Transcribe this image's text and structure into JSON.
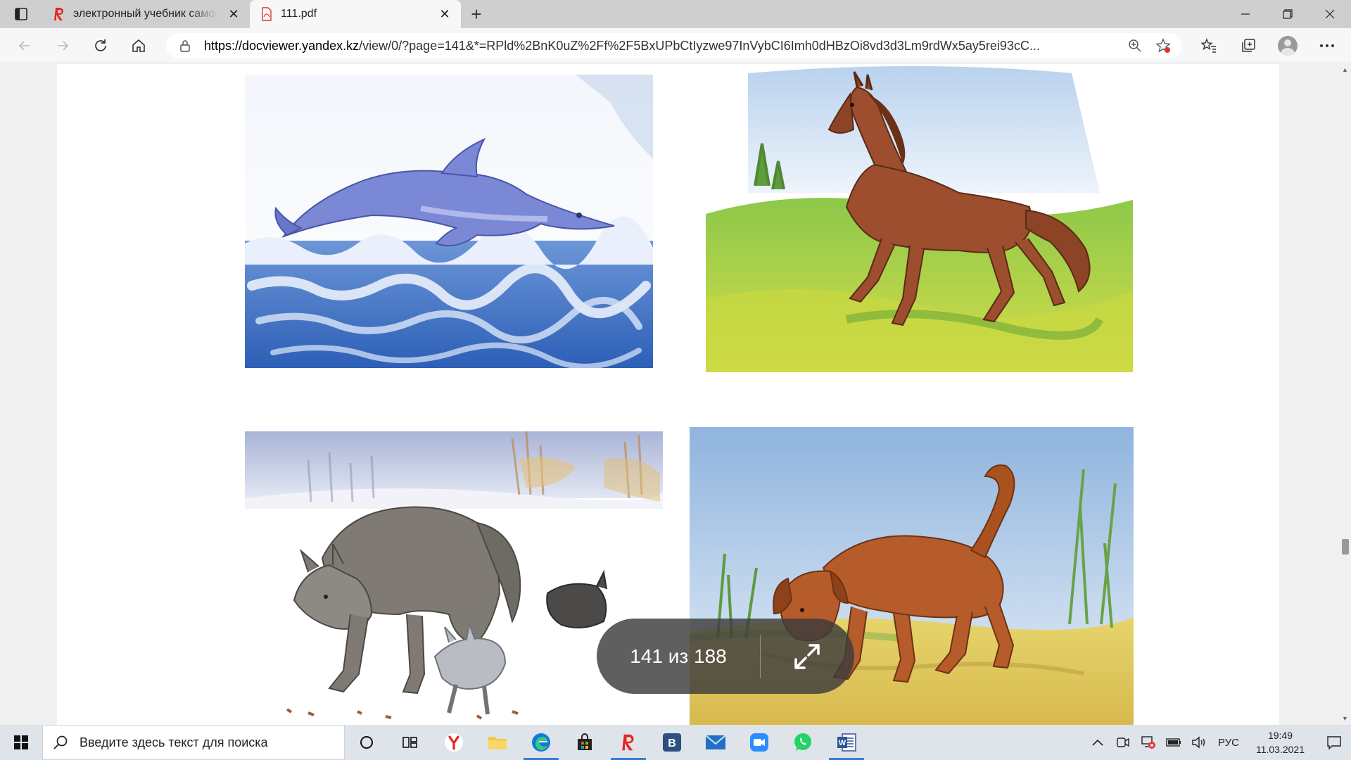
{
  "tabs": [
    {
      "title": "электронный учебник самопознание",
      "active": false,
      "icon": "yandex-icon"
    },
    {
      "title": "111.pdf",
      "active": true,
      "icon": "pdf-icon"
    }
  ],
  "toolbar": {
    "url_domain": "https://docviewer.yandex.kz",
    "url_rest": "/view/0/?page=141&*=RPld%2BnK0uZ%2Ff%2F5BxUPbCtIyzwe97InVybCI6Imh0dHBzOi8vd3d3Lm9rdWx5ay5rei93cC..."
  },
  "viewer": {
    "page_indicator": "141 из 188"
  },
  "taskbar": {
    "search_placeholder": "Введите здесь текст для поиска",
    "lang": "РУС",
    "time": "19:49",
    "date": "11.03.2021"
  },
  "colors": {
    "accent": "#3a7bd5",
    "yandex_red": "#e52620",
    "edge_blue": "#0f7bd3"
  }
}
